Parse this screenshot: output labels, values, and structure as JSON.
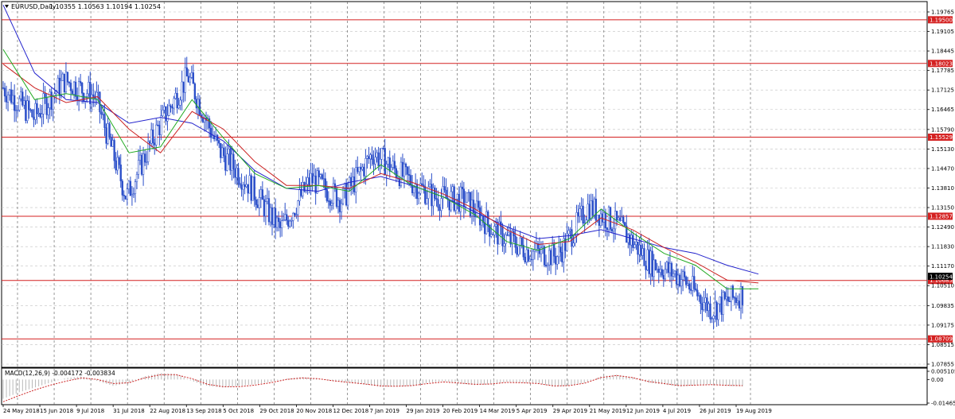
{
  "chart_data": [
    {
      "type": "candlestick",
      "symbol": "EURUSD,Daily",
      "ohlc_header": "1.10355 1.10563 1.10194 1.10254",
      "last_price": "1.10254",
      "ylim": [
        1.07855,
        1.20085
      ],
      "y_ticks": [
        "1.19765",
        "1.19105",
        "1.18445",
        "1.17785",
        "1.17125",
        "1.16465",
        "1.15790",
        "1.15130",
        "1.14470",
        "1.13810",
        "1.13150",
        "1.12490",
        "1.11830",
        "1.11170",
        "1.10510",
        "1.09835",
        "1.09175",
        "1.08515",
        "1.07855"
      ],
      "x_ticks": [
        "24 May 2018",
        "15 Jun 2018",
        "9 Jul 2018",
        "31 Jul 2018",
        "22 Aug 2018",
        "13 Sep 2018",
        "5 Oct 2018",
        "29 Oct 2018",
        "20 Nov 2018",
        "12 Dec 2018",
        "7 Jan 2019",
        "29 Jan 2019",
        "20 Feb 2019",
        "14 Mar 2019",
        "5 Apr 2019",
        "29 Apr 2019",
        "21 May 2019",
        "12 Jun 2019",
        "4 Jul 2019",
        "26 Jul 2019",
        "19 Aug 2019"
      ],
      "horizontal_levels": [
        "1.19500",
        "1.18023",
        "1.15529",
        "1.12857",
        "1.10685",
        "1.08709"
      ],
      "price_series": [
        {
          "date": "24 May 2018",
          "price": 1.172
        },
        {
          "date": "15 Jun 2018",
          "price": 1.162
        },
        {
          "date": "9 Jul 2018",
          "price": 1.1745
        },
        {
          "date": "31 Jul 2018",
          "price": 1.169
        },
        {
          "date": "15 Aug 2018",
          "price": 1.135
        },
        {
          "date": "22 Aug 2018",
          "price": 1.158
        },
        {
          "date": "13 Sep 2018",
          "price": 1.176
        },
        {
          "date": "5 Oct 2018",
          "price": 1.151
        },
        {
          "date": "29 Oct 2018",
          "price": 1.139
        },
        {
          "date": "12 Nov 2018",
          "price": 1.124
        },
        {
          "date": "20 Nov 2018",
          "price": 1.141
        },
        {
          "date": "12 Dec 2018",
          "price": 1.134
        },
        {
          "date": "7 Jan 2019",
          "price": 1.15
        },
        {
          "date": "29 Jan 2019",
          "price": 1.142
        },
        {
          "date": "20 Feb 2019",
          "price": 1.135
        },
        {
          "date": "14 Mar 2019",
          "price": 1.134
        },
        {
          "date": "5 Apr 2019",
          "price": 1.123
        },
        {
          "date": "29 Apr 2019",
          "price": 1.117
        },
        {
          "date": "21 May 2019",
          "price": 1.115
        },
        {
          "date": "12 Jun 2019",
          "price": 1.132
        },
        {
          "date": "4 Jul 2019",
          "price": 1.125
        },
        {
          "date": "26 Jul 2019",
          "price": 1.113
        },
        {
          "date": "19 Aug 2019",
          "price": 1.108
        },
        {
          "date": "1 Sep 2019",
          "price": 1.097
        },
        {
          "date": "6 Sep 2019",
          "price": 1.1025
        }
      ],
      "moving_averages": [
        {
          "color": "#2222cc",
          "values": [
            1.2,
            1.177,
            1.168,
            1.167,
            1.16,
            1.162,
            1.16,
            1.154,
            1.144,
            1.138,
            1.137,
            1.14,
            1.142,
            1.139,
            1.135,
            1.13,
            1.125,
            1.121,
            1.122,
            1.124,
            1.121,
            1.118,
            1.116,
            1.112,
            1.109
          ]
        },
        {
          "color": "#cc2222",
          "values": [
            1.18,
            1.172,
            1.167,
            1.169,
            1.158,
            1.15,
            1.164,
            1.158,
            1.147,
            1.139,
            1.139,
            1.138,
            1.143,
            1.14,
            1.136,
            1.131,
            1.124,
            1.119,
            1.12,
            1.128,
            1.124,
            1.118,
            1.113,
            1.107,
            1.106
          ]
        },
        {
          "color": "#22aa22",
          "values": [
            1.185,
            1.168,
            1.17,
            1.168,
            1.15,
            1.152,
            1.168,
            1.155,
            1.143,
            1.138,
            1.139,
            1.137,
            1.146,
            1.139,
            1.135,
            1.129,
            1.12,
            1.117,
            1.121,
            1.131,
            1.123,
            1.116,
            1.112,
            1.104,
            1.104
          ]
        }
      ]
    },
    {
      "type": "macd",
      "label": "MACD(12,26,9) -0.004172 -0.003834",
      "ylim": [
        -0.014658,
        0.005105
      ],
      "y_ticks": [
        "0.005105",
        "0.00",
        "-0.014658"
      ],
      "histogram": [
        -0.012,
        -0.008,
        -0.005,
        -0.002,
        0.001,
        0.002,
        -0.001,
        -0.004,
        -0.002,
        0.002,
        0.004,
        0.0035,
        -0.001,
        -0.004,
        -0.005,
        -0.004,
        -0.003,
        -0.0015,
        0.0005,
        0.0015,
        0.0005,
        -0.001,
        -0.002,
        -0.003,
        -0.0045,
        -0.0045,
        -0.004,
        -0.002,
        -0.001,
        -0.0025,
        -0.0035,
        -0.003,
        -0.0015,
        -0.002,
        -0.0025,
        -0.0045,
        -0.004,
        -0.002,
        0.002,
        0.003,
        0.0015,
        -0.002,
        -0.003,
        -0.0045,
        -0.0035,
        -0.003,
        -0.004,
        -0.0042
      ],
      "signal": [
        -0.0138,
        -0.01,
        -0.0065,
        -0.0035,
        -0.001,
        0.001,
        0.0,
        -0.0025,
        -0.002,
        0.001,
        0.003,
        0.003,
        0.0005,
        -0.003,
        -0.0045,
        -0.0045,
        -0.0035,
        -0.002,
        0.0,
        0.001,
        0.0005,
        -0.0008,
        -0.0018,
        -0.0028,
        -0.004,
        -0.0042,
        -0.0038,
        -0.0025,
        -0.0015,
        -0.0022,
        -0.003,
        -0.0028,
        -0.0018,
        -0.002,
        -0.0025,
        -0.004,
        -0.0038,
        -0.0022,
        0.0012,
        0.0025,
        0.0012,
        -0.0012,
        -0.0025,
        -0.0038,
        -0.0035,
        -0.0032,
        -0.0036,
        -0.0038
      ]
    }
  ]
}
